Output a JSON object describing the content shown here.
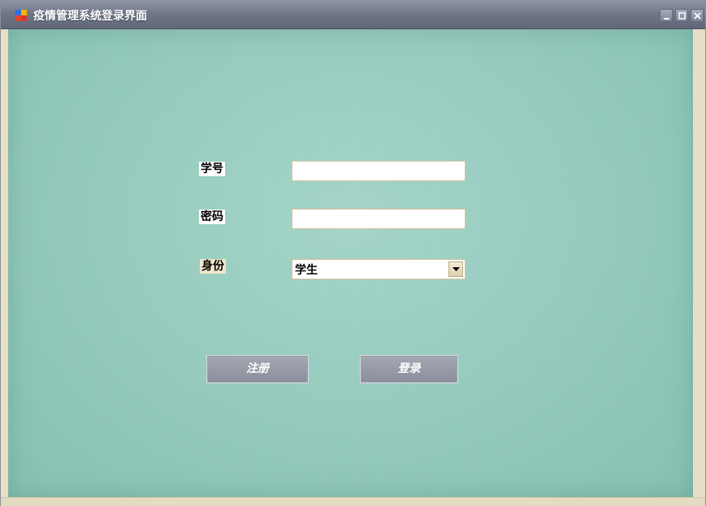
{
  "window": {
    "title": "疫情管理系统登录界面"
  },
  "form": {
    "student_id_label": "学号",
    "student_id_value": "",
    "password_label": "密码",
    "password_value": "",
    "role_label": "身份",
    "role_selected": "学生"
  },
  "buttons": {
    "register": "注册",
    "login": "登录"
  },
  "icons": {
    "app": "app-icon",
    "minimize": "minimize-icon",
    "maximize": "maximize-icon",
    "close": "close-icon",
    "dropdown": "chevron-down-icon"
  },
  "colors": {
    "titlebar": "#6f7789",
    "background": "#93c9bc",
    "button": "#8a8f9b"
  }
}
